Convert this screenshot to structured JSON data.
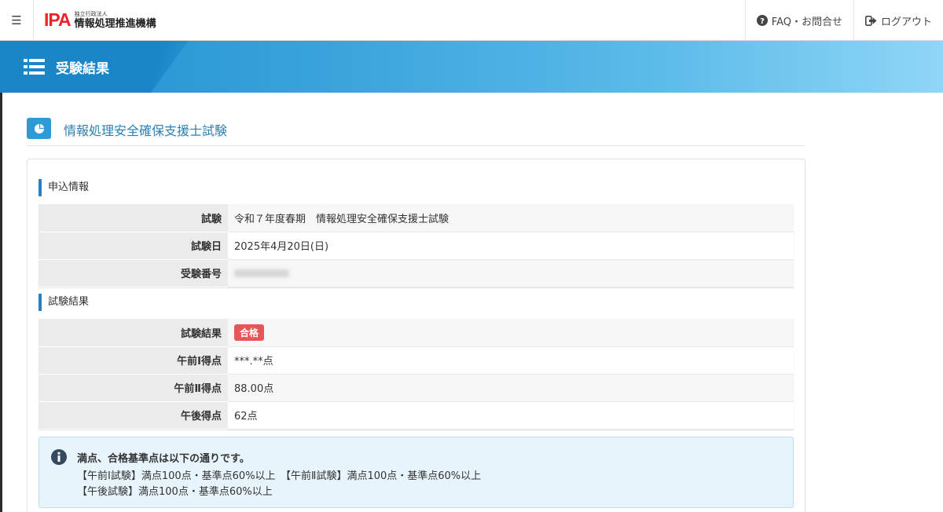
{
  "navbar": {
    "logo_mark": "IPA",
    "logo_small": "独立行政法人",
    "logo_name": "情報処理推進機構",
    "faq_label": "FAQ・お問合せ",
    "logout_label": "ログアウト"
  },
  "page_header": {
    "title": "受験結果"
  },
  "exam": {
    "title": "情報処理安全確保支援士試験"
  },
  "application": {
    "section_label": "申込情報",
    "rows": [
      {
        "label": "試験",
        "value": "令和７年度春期　情報処理安全確保支援士試験"
      },
      {
        "label": "試験日",
        "value": "2025年4月20日(日)"
      },
      {
        "label": "受験番号",
        "value": ""
      }
    ]
  },
  "result": {
    "section_label": "試験結果",
    "status_label": "試験結果",
    "status_badge": "合格",
    "rows": [
      {
        "label": "午前Ⅰ得点",
        "value": "***.**点"
      },
      {
        "label": "午前Ⅱ得点",
        "value": "88.00点"
      },
      {
        "label": "午後得点",
        "value": "62点"
      }
    ]
  },
  "notice": {
    "title": "満点、合格基準点は以下の通りです。",
    "line1": "【午前Ⅰ試験】満点100点・基準点60%以上　【午前Ⅱ試験】満点100点・基準点60%以上",
    "line2": "【午後試験】満点100点・基準点60%以上"
  },
  "colors": {
    "accent": "#2f9bd6",
    "pass_badge": "#e55656",
    "brand_red": "#e8232a"
  }
}
